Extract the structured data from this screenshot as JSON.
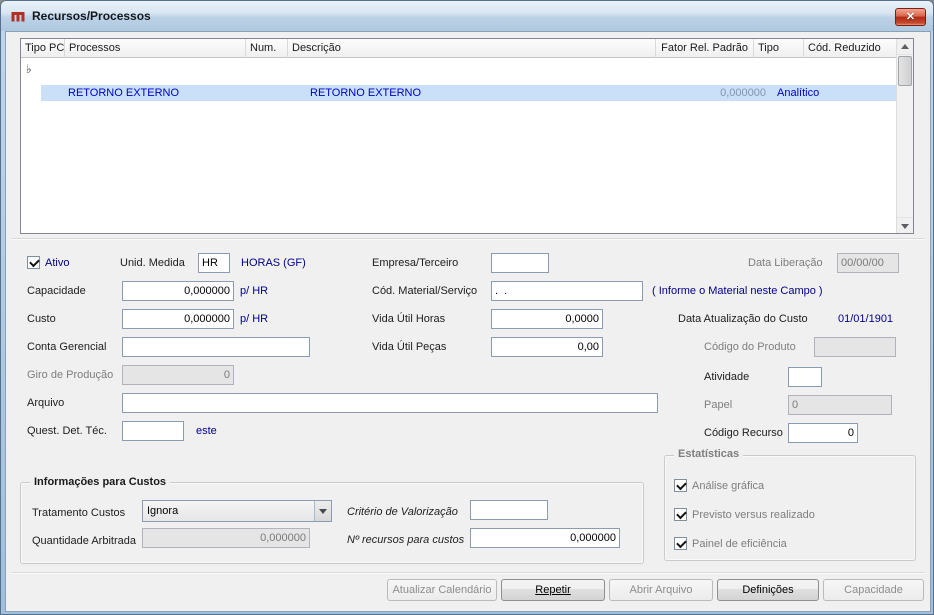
{
  "window": {
    "title": "Recursos/Processos"
  },
  "icons": {
    "close": "✕",
    "row_marker": "♭"
  },
  "grid": {
    "columns": [
      "Tipo PCP",
      "Processos",
      "Num.",
      "Descrição",
      "Fator Rel. Padrão",
      "Tipo",
      "Cód. Reduzido"
    ],
    "selected_row": {
      "marker": "♭",
      "processos": "RETORNO EXTERNO",
      "num": "",
      "descricao": "RETORNO EXTERNO",
      "fator": "0,000000",
      "tipo": "Analítico",
      "cod_reduzido": ""
    }
  },
  "form": {
    "ativo": {
      "label": "Ativo"
    },
    "unid_medida": {
      "label": "Unid. Medida",
      "value": "HR",
      "suffix": "HORAS (GF)"
    },
    "empresa_terceiro": {
      "label": "Empresa/Terceiro",
      "value": ""
    },
    "data_liberacao": {
      "label": "Data Liberação",
      "value": "00/00/00"
    },
    "capacidade": {
      "label": "Capacidade",
      "value": "0,000000",
      "suffix": "p/ HR"
    },
    "cod_material": {
      "label": "Cód. Material/Serviço",
      "value": ".  .",
      "hint": "( Informe o Material neste Campo )"
    },
    "custo": {
      "label": "Custo",
      "value": "0,000000",
      "suffix": "p/ HR"
    },
    "vida_util_horas": {
      "label": "Vida Útil Horas",
      "value": "0,0000"
    },
    "data_atualizacao": {
      "label": "Data Atualização do Custo",
      "value": "01/01/1901"
    },
    "conta_gerencial": {
      "label": "Conta Gerencial",
      "value": ""
    },
    "vida_util_pecas": {
      "label": "Vida Útil Peças",
      "value": "0,00"
    },
    "codigo_produto": {
      "label": "Código do Produto",
      "value": ""
    },
    "giro_producao": {
      "label": "Giro de Produção",
      "value": "0"
    },
    "atividade": {
      "label": "Atividade",
      "value": ""
    },
    "arquivo": {
      "label": "Arquivo",
      "value": ""
    },
    "papel": {
      "label": "Papel",
      "value": "0"
    },
    "quest_det_tec": {
      "label": "Quest. Det. Téc.",
      "value": "",
      "link": "este"
    },
    "codigo_recurso": {
      "label": "Código Recurso",
      "value": "0"
    }
  },
  "custos_group": {
    "title": "Informações para Custos",
    "tratamento": {
      "label": "Tratamento Custos",
      "value": "Ignora"
    },
    "criterio": {
      "label": "Critério de Valorização",
      "value": ""
    },
    "quantidade": {
      "label": "Quantidade Arbitrada",
      "value": "0,000000"
    },
    "n_recursos": {
      "label": "Nº recursos para custos",
      "value": "0,000000"
    }
  },
  "estatisticas_group": {
    "title": "Estatísticas",
    "items": [
      {
        "label": "Análise gráfica",
        "checked": true
      },
      {
        "label": "Previsto versus realizado",
        "checked": true
      },
      {
        "label": "Painel de eficiência",
        "checked": true
      }
    ]
  },
  "buttons": [
    {
      "label": "Atualizar Calendário",
      "enabled": false
    },
    {
      "label": "Repetir",
      "enabled": true
    },
    {
      "label": "Abrir Arquivo",
      "enabled": false
    },
    {
      "label": "Definições",
      "enabled": true
    },
    {
      "label": "Capacidade",
      "enabled": false
    }
  ]
}
